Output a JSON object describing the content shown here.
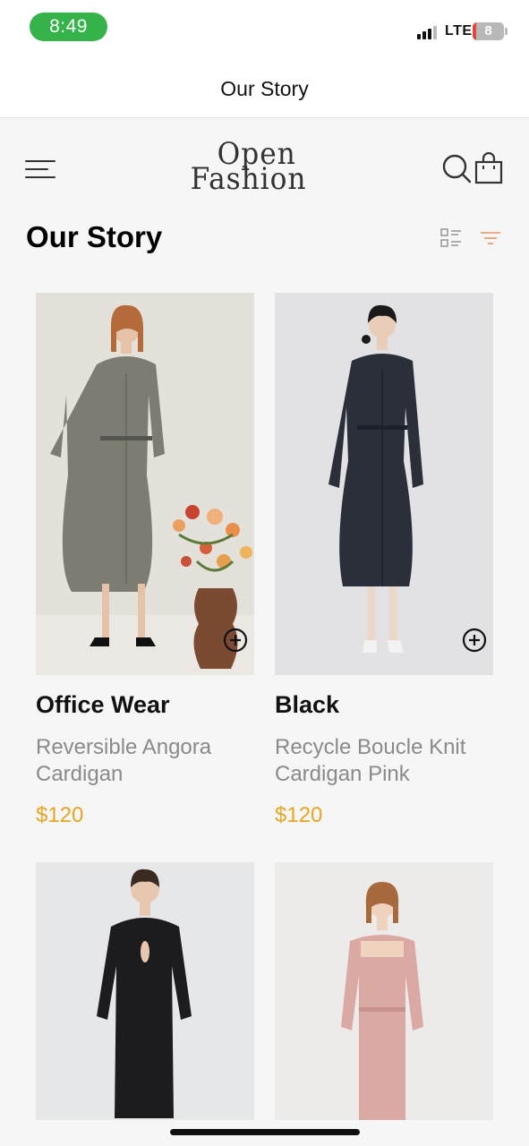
{
  "status_bar": {
    "time": "8:49",
    "network": "LTE",
    "battery": "8"
  },
  "nav": {
    "title": "Our Story"
  },
  "header": {
    "logo_line1": "Open",
    "logo_line2": "Fashion",
    "icons": [
      "menu-icon",
      "search-icon",
      "shopping-bag-icon"
    ]
  },
  "section": {
    "title": "Our Story",
    "view_icons": [
      "grid-view-icon",
      "filter-icon"
    ],
    "accent_color": "#e8a521"
  },
  "products": [
    {
      "title": "Office Wear",
      "description": "Reversible Angora Cardigan",
      "price": "$120",
      "dress_color": "#7c7c72",
      "bg_color": "#e4e0da"
    },
    {
      "title": "Black",
      "description": "Recycle Boucle Knit Cardigan Pink",
      "price": "$120",
      "dress_color": "#2b2f3a",
      "bg_color": "#e2e2e4"
    },
    {
      "title": "",
      "description": "",
      "price": "",
      "dress_color": "#1c1c1e",
      "bg_color": "#e6e7e9"
    },
    {
      "title": "",
      "description": "",
      "price": "",
      "dress_color": "#dba9a3",
      "bg_color": "#ecebe9"
    }
  ]
}
